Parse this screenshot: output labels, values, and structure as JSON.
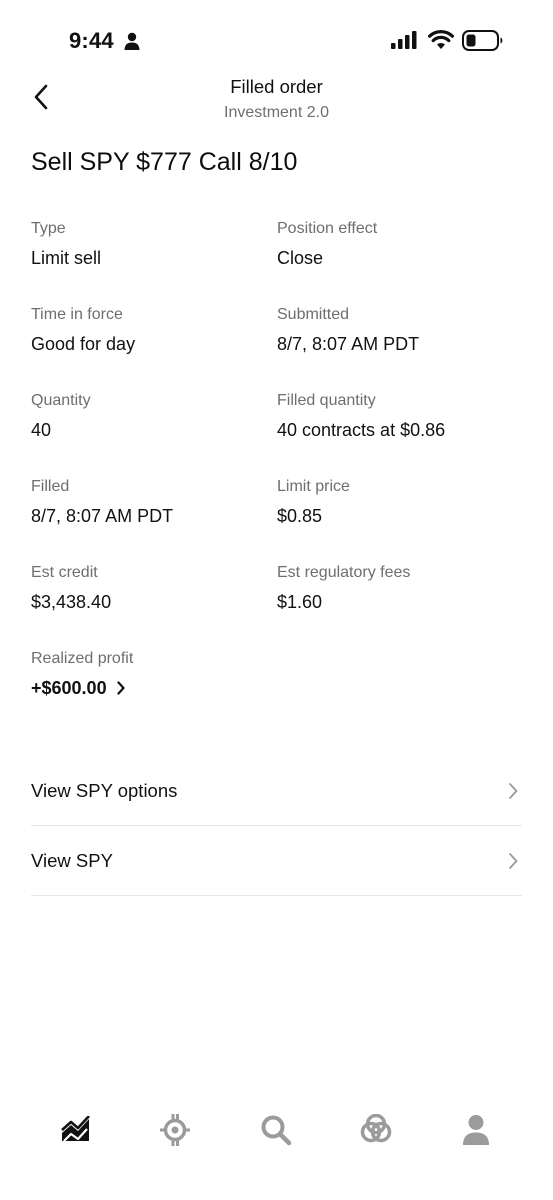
{
  "status_bar": {
    "time": "9:44"
  },
  "header": {
    "title": "Filled order",
    "subtitle": "Investment 2.0"
  },
  "order": {
    "title": "Sell SPY $777 Call 8/10",
    "details": [
      {
        "label": "Type",
        "value": "Limit sell"
      },
      {
        "label": "Position effect",
        "value": "Close"
      },
      {
        "label": "Time in force",
        "value": "Good for day"
      },
      {
        "label": "Submitted",
        "value": "8/7, 8:07 AM PDT"
      },
      {
        "label": "Quantity",
        "value": "40"
      },
      {
        "label": "Filled quantity",
        "value": "40 contracts at $0.86"
      },
      {
        "label": "Filled",
        "value": "8/7, 8:07 AM PDT"
      },
      {
        "label": "Limit price",
        "value": "$0.85"
      },
      {
        "label": "Est credit",
        "value": "$3,438.40"
      },
      {
        "label": "Est regulatory fees",
        "value": "$1.60"
      }
    ],
    "realized_profit": {
      "label": "Realized profit",
      "value": "+$600.00"
    }
  },
  "links": [
    {
      "label": "View SPY options"
    },
    {
      "label": "View SPY"
    }
  ],
  "tab_bar": {
    "tabs": [
      {
        "icon": "chart-icon",
        "active": true
      },
      {
        "icon": "options-icon",
        "active": false
      },
      {
        "icon": "search-icon",
        "active": false
      },
      {
        "icon": "network-icon",
        "active": false
      },
      {
        "icon": "account-icon",
        "active": false
      }
    ],
    "active_color": "#111111",
    "inactive_color": "#9b9b9b"
  }
}
